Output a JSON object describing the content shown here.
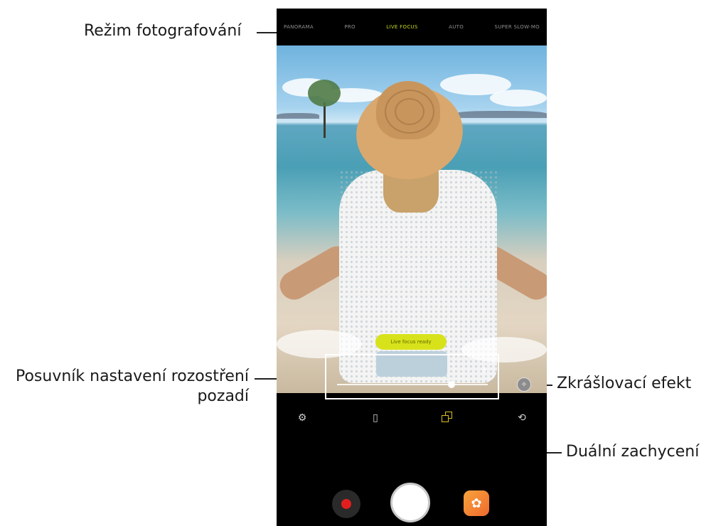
{
  "callouts": {
    "shooting_mode": "Režim fotografování",
    "blur_slider_line1": "Posuvník nastavení rozostření",
    "blur_slider_line2": "pozadí",
    "beauty_effect": "Zkrášlovací efekt",
    "dual_capture": "Duální zachycení"
  },
  "camera": {
    "modes": [
      "PANORAMA",
      "PRO",
      "LIVE FOCUS",
      "AUTO",
      "SUPER SLOW-MO"
    ],
    "active_mode": "LIVE FOCUS",
    "live_focus_label": "Live focus ready",
    "blur_value": "5",
    "blur_level_fraction": 0.76,
    "icons": [
      "settings-icon",
      "aspect-ratio-icon",
      "dual-capture-icon",
      "switch-camera-icon",
      "record-icon",
      "shutter-icon",
      "effects-icon",
      "beauty-icon"
    ]
  },
  "colors": {
    "active_mode": "#c7d81e",
    "record": "#e31e1e",
    "dual_capture": "#d9be22",
    "effects": "#f0832f"
  }
}
